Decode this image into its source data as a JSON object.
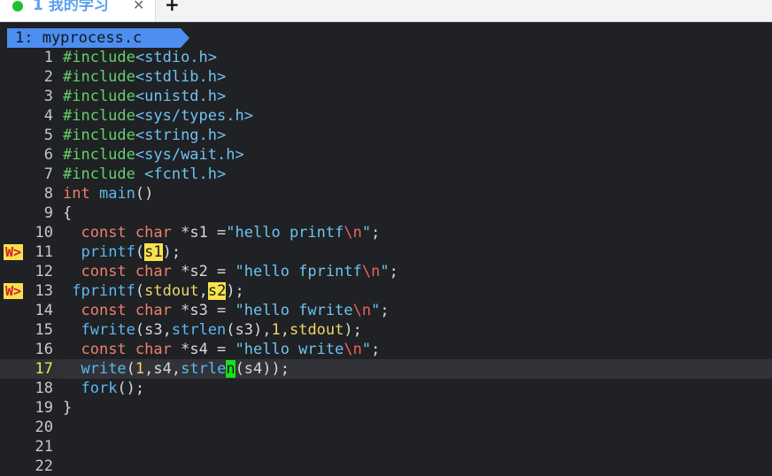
{
  "tabbar": {
    "active_tab_title": "1 我的学习",
    "close_label": "✕",
    "add_label": "+",
    "status_color": "#20c12d"
  },
  "buffer": {
    "tab_label": "1: myprocess.c"
  },
  "editor": {
    "current_line": 17,
    "lines": [
      {
        "n": "1",
        "sign": "",
        "tokens": [
          [
            "#include",
            "pp"
          ],
          [
            "<stdio.h>",
            "str"
          ]
        ]
      },
      {
        "n": "2",
        "sign": "",
        "tokens": [
          [
            "#include",
            "pp"
          ],
          [
            "<stdlib.h>",
            "str"
          ]
        ]
      },
      {
        "n": "3",
        "sign": "",
        "tokens": [
          [
            "#include",
            "pp"
          ],
          [
            "<unistd.h>",
            "str"
          ]
        ]
      },
      {
        "n": "4",
        "sign": "",
        "tokens": [
          [
            "#include",
            "pp"
          ],
          [
            "<sys/types.h>",
            "str"
          ]
        ]
      },
      {
        "n": "5",
        "sign": "",
        "tokens": [
          [
            "#include",
            "pp"
          ],
          [
            "<string.h>",
            "str"
          ]
        ]
      },
      {
        "n": "6",
        "sign": "",
        "tokens": [
          [
            "#include",
            "pp"
          ],
          [
            "<sys/wait.h>",
            "str"
          ]
        ]
      },
      {
        "n": "7",
        "sign": "",
        "tokens": [
          [
            "#include ",
            "pp"
          ],
          [
            "<fcntl.h>",
            "str"
          ]
        ]
      },
      {
        "n": "8",
        "sign": "",
        "tokens": [
          [
            "int",
            "kw"
          ],
          [
            " ",
            "plain"
          ],
          [
            "main",
            "fn"
          ],
          [
            "()",
            "plain"
          ]
        ]
      },
      {
        "n": "9",
        "sign": "",
        "tokens": [
          [
            "{",
            "plain"
          ]
        ]
      },
      {
        "n": "10",
        "sign": "",
        "tokens": [
          [
            "  ",
            "plain"
          ],
          [
            "const",
            "kw"
          ],
          [
            " ",
            "plain"
          ],
          [
            "char",
            "kw"
          ],
          [
            " *s1 =",
            "plain"
          ],
          [
            "\"hello printf",
            "str"
          ],
          [
            "\\n",
            "esc"
          ],
          [
            "\"",
            "str"
          ],
          [
            ";",
            "plain"
          ]
        ]
      },
      {
        "n": "11",
        "sign": "W>",
        "tokens": [
          [
            "  ",
            "plain"
          ],
          [
            "printf",
            "fn"
          ],
          [
            "(",
            "plain"
          ],
          [
            "s1",
            "err"
          ],
          [
            ");",
            "plain"
          ]
        ]
      },
      {
        "n": "12",
        "sign": "",
        "tokens": [
          [
            "  ",
            "plain"
          ],
          [
            "const",
            "kw"
          ],
          [
            " ",
            "plain"
          ],
          [
            "char",
            "kw"
          ],
          [
            " *s2 = ",
            "plain"
          ],
          [
            "\"hello fprintf",
            "str"
          ],
          [
            "\\n",
            "esc"
          ],
          [
            "\"",
            "str"
          ],
          [
            ";",
            "plain"
          ]
        ]
      },
      {
        "n": "13",
        "sign": "W>",
        "tokens": [
          [
            " ",
            "plain"
          ],
          [
            "fprintf",
            "fn"
          ],
          [
            "(",
            "plain"
          ],
          [
            "stdout",
            "num"
          ],
          [
            ",",
            "plain"
          ],
          [
            "s2",
            "err"
          ],
          [
            ");",
            "plain"
          ]
        ]
      },
      {
        "n": "14",
        "sign": "",
        "tokens": [
          [
            "  ",
            "plain"
          ],
          [
            "const",
            "kw"
          ],
          [
            " ",
            "plain"
          ],
          [
            "char",
            "kw"
          ],
          [
            " *s3 = ",
            "plain"
          ],
          [
            "\"hello fwrite",
            "str"
          ],
          [
            "\\n",
            "esc"
          ],
          [
            "\"",
            "str"
          ],
          [
            ";",
            "plain"
          ]
        ]
      },
      {
        "n": "15",
        "sign": "",
        "tokens": [
          [
            "  ",
            "plain"
          ],
          [
            "fwrite",
            "fn"
          ],
          [
            "(s3,",
            "plain"
          ],
          [
            "strlen",
            "fn"
          ],
          [
            "(s3),",
            "plain"
          ],
          [
            "1",
            "num"
          ],
          [
            ",",
            "plain"
          ],
          [
            "stdout",
            "num"
          ],
          [
            ");",
            "plain"
          ]
        ]
      },
      {
        "n": "16",
        "sign": "",
        "tokens": [
          [
            "  ",
            "plain"
          ],
          [
            "const",
            "kw"
          ],
          [
            " ",
            "plain"
          ],
          [
            "char",
            "kw"
          ],
          [
            " *s4 = ",
            "plain"
          ],
          [
            "\"hello write",
            "str"
          ],
          [
            "\\n",
            "esc"
          ],
          [
            "\"",
            "str"
          ],
          [
            ";",
            "plain"
          ]
        ]
      },
      {
        "n": "17",
        "sign": "",
        "tokens": [
          [
            "  ",
            "plain"
          ],
          [
            "write",
            "fn"
          ],
          [
            "(",
            "plain"
          ],
          [
            "1",
            "num"
          ],
          [
            ",s4,",
            "plain"
          ],
          [
            "strle",
            "fn"
          ],
          [
            "n",
            "cur"
          ],
          [
            "(s4));",
            "plain"
          ]
        ]
      },
      {
        "n": "18",
        "sign": "",
        "tokens": [
          [
            "  ",
            "plain"
          ],
          [
            "fork",
            "fn"
          ],
          [
            "();",
            "plain"
          ]
        ]
      },
      {
        "n": "19",
        "sign": "",
        "tokens": [
          [
            "}",
            "plain"
          ]
        ]
      },
      {
        "n": "20",
        "sign": "",
        "tokens": []
      },
      {
        "n": "21",
        "sign": "",
        "tokens": []
      },
      {
        "n": "22",
        "sign": "",
        "tokens": []
      }
    ]
  }
}
